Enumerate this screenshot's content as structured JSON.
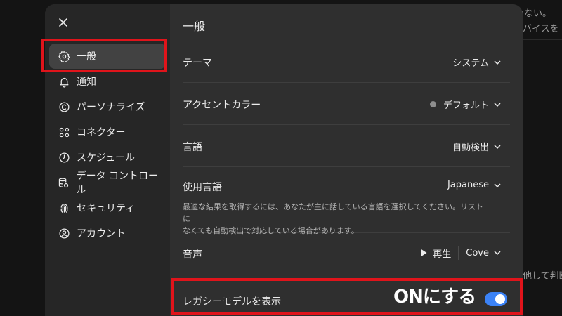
{
  "background": {
    "line1": "休めない。",
    "line2": "バイスを",
    "line3": "他して判断"
  },
  "sidebar": {
    "items": [
      {
        "label": "一般",
        "icon": "gear-icon",
        "active": true
      },
      {
        "label": "通知",
        "icon": "bell-icon",
        "active": false
      },
      {
        "label": "パーソナライズ",
        "icon": "personalize-icon",
        "active": false
      },
      {
        "label": "コネクター",
        "icon": "connector-icon",
        "active": false
      },
      {
        "label": "スケジュール",
        "icon": "clock-icon",
        "active": false
      },
      {
        "label": "データ コントロール",
        "icon": "database-icon",
        "active": false
      },
      {
        "label": "セキュリティ",
        "icon": "fingerprint-icon",
        "active": false
      },
      {
        "label": "アカウント",
        "icon": "account-icon",
        "active": false
      }
    ]
  },
  "main": {
    "title": "一般",
    "theme": {
      "label": "テーマ",
      "value": "システム"
    },
    "accent": {
      "label": "アクセントカラー",
      "value": "デフォルト",
      "dot_color": "#8e8e8e"
    },
    "language": {
      "label": "言語",
      "value": "自動検出"
    },
    "spoken_language": {
      "label": "使用言語",
      "value": "Japanese",
      "description_line1": "最適な結果を取得するには、あなたが主に話している言語を選択してください。リストに",
      "description_line2": "なくても自動検出で対応している場合があります。"
    },
    "voice": {
      "label": "音声",
      "play_label": "再生",
      "value": "Cove"
    },
    "legacy_models": {
      "label": "レガシーモデルを表示",
      "enabled": true
    }
  },
  "annotation": {
    "callout": "ONにする",
    "color": "#e0141b"
  },
  "colors": {
    "toggle_on": "#3b82f6",
    "modal_bg": "#2f2f2f",
    "sidebar_bg": "#262626"
  }
}
